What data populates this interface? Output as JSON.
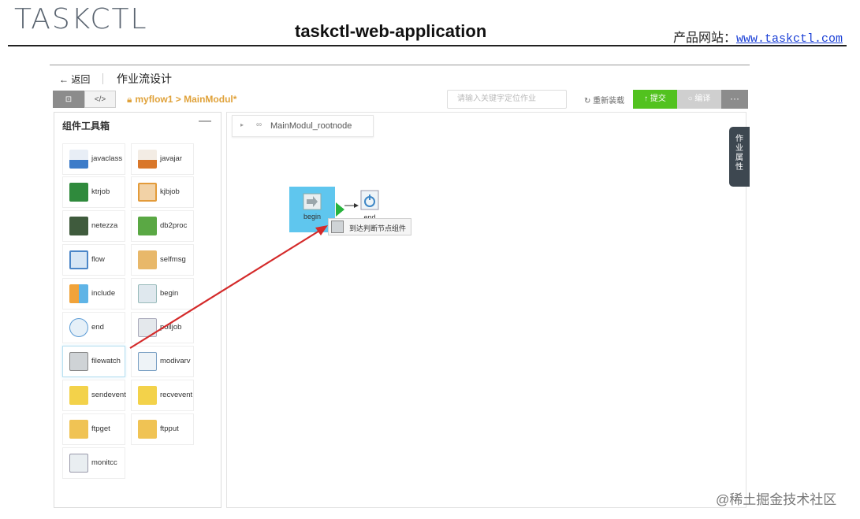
{
  "doc": {
    "logo": "TASKCTL",
    "title": "taskctl-web-application",
    "site_label": "产品网站：",
    "site_url": "www.taskctl.com"
  },
  "app": {
    "back_label": "返回",
    "page_title": "作业流设计",
    "toolbar": {
      "btn1": "⊡",
      "btn2": "</>",
      "breadcrumb": "myflow1 > MainModul*",
      "search_placeholder": "请输入关键字定位作业",
      "reload_label": "重新装载",
      "submit_label": "提交",
      "compile_label": "编译",
      "more_label": "···"
    },
    "panel": {
      "title": "组件工具箱",
      "collapse": "—",
      "components": [
        {
          "label": "javaclass",
          "icon": "javaclass-icon"
        },
        {
          "label": "javajar",
          "icon": "javajar-icon"
        },
        {
          "label": "ktrjob",
          "icon": "ktrjob-icon"
        },
        {
          "label": "kjbjob",
          "icon": "kjbjob-icon"
        },
        {
          "label": "netezza",
          "icon": "netezza-icon"
        },
        {
          "label": "db2proc",
          "icon": "db2proc-icon"
        },
        {
          "label": "flow",
          "icon": "flow-icon"
        },
        {
          "label": "selfmsg",
          "icon": "selfmsg-icon"
        },
        {
          "label": "include",
          "icon": "include-icon"
        },
        {
          "label": "begin",
          "icon": "begin-icon"
        },
        {
          "label": "end",
          "icon": "end-icon"
        },
        {
          "label": "polljob",
          "icon": "polljob-icon"
        },
        {
          "label": "filewatch",
          "icon": "filewatch-icon"
        },
        {
          "label": "modivarv",
          "icon": "modivarv-icon"
        },
        {
          "label": "sendevent",
          "icon": "sendevent-icon"
        },
        {
          "label": "recvevent",
          "icon": "recvevent-icon"
        },
        {
          "label": "ftpget",
          "icon": "ftpget-icon"
        },
        {
          "label": "ftpput",
          "icon": "ftpput-icon"
        },
        {
          "label": "monitcc",
          "icon": "monitcc-icon"
        }
      ]
    },
    "canvas": {
      "tab_label": "MainModul_rootnode",
      "nodes": {
        "begin": "begin",
        "end": "end"
      },
      "drag_tooltip": "到达判断节点组件"
    },
    "props_tab": [
      "作",
      "业",
      "属",
      "性"
    ]
  },
  "watermark": "@稀土掘金技术社区",
  "colors": {
    "accent_green": "#52c21f",
    "node_blue": "#5fc6ee",
    "arrow_red": "#d42a2a",
    "crumb_orange": "#e0a23a"
  }
}
